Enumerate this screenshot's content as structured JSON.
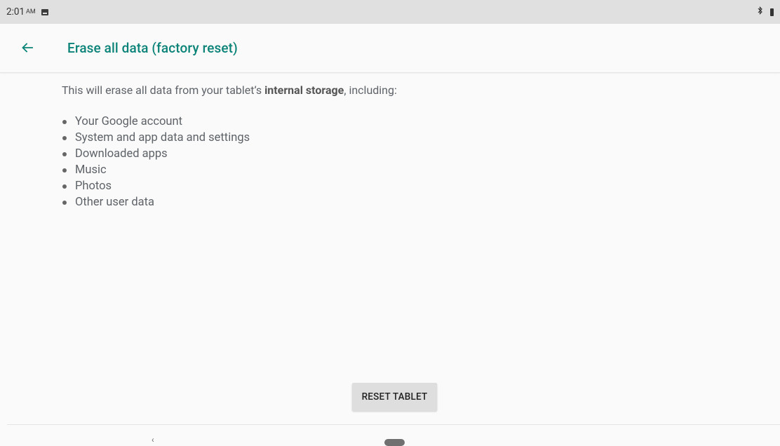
{
  "status_bar": {
    "time": "2:01",
    "ampm": "AM",
    "notification_icon": "image-icon",
    "bluetooth_icon": "bluetooth-icon",
    "battery_icon": "battery-icon"
  },
  "app_bar": {
    "back_icon": "arrow-back-icon",
    "title": "Erase all data (factory reset)"
  },
  "content": {
    "description_prefix": "This will erase all data from your tablet’s ",
    "description_bold": "internal storage",
    "description_suffix": ", including:",
    "items": [
      "Your Google account",
      "System and app data and settings",
      "Downloaded apps",
      "Music",
      "Photos",
      "Other user data"
    ]
  },
  "reset_button": {
    "label": "RESET TABLET"
  },
  "nav_bar": {
    "back_label": "‹",
    "home_icon": "home-pill-icon"
  },
  "colors": {
    "accent": "#0b8377",
    "status_bar_bg": "#e0e0e0",
    "background": "#fafafa",
    "button_bg": "#dedede"
  }
}
